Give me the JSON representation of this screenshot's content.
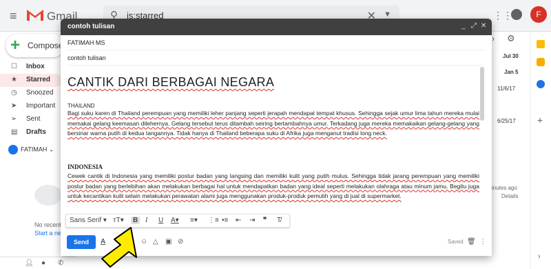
{
  "gmail": {
    "brand": "Gmail",
    "search_value": "is:starred",
    "compose_label": "Compose",
    "nav": [
      {
        "icon": "☐",
        "label": "Inbox",
        "bold": true
      },
      {
        "icon": "★",
        "label": "Starred",
        "bold": true,
        "active": true
      },
      {
        "icon": "◷",
        "label": "Snoozed",
        "bold": false
      },
      {
        "icon": "➤",
        "label": "Important",
        "bold": false
      },
      {
        "icon": "➢",
        "label": "Sent",
        "bold": false
      },
      {
        "icon": "▤",
        "label": "Drafts",
        "bold": true
      }
    ],
    "user_label": "FATIMAH ⌄",
    "avatar_letter": "F",
    "no_recent": "No recent c",
    "start_new": "Start a new",
    "dates": [
      "Jul 30",
      "Jan 5",
      "11/6/17",
      "6/25/17"
    ],
    "minutes_ago": "inutes ago",
    "details": "Details"
  },
  "compose": {
    "title": "contoh tulisan",
    "to": "FATIMAH MS",
    "subject": "contoh tulisan",
    "heading": "CANTIK DARI BERBAGAI NEGARA",
    "section1_label": "THAILAND",
    "section1_text": "Bagi suku karen di Thailand perempuan yang memiliki leher panjang seperti jerapah mendapat tempat khusus. Sehingga sejak umur lima tahun mereka mulai memakai gelang keemasan dilehernya. Gelang tersebut terus ditambah seiring bertambahnya umur. Terkadang juga mereka memakaikan gelang-gelang yang bersinar warna putih  di  kedua tangannya. Tidak hanya di Thailand beberapa suku di Afrika juga menganut tradisi long neck.",
    "section2_label": "INDONESIA",
    "section2_text": "Cewek cantik di Indonesia yang memiliki postur badan yang langsing dan memiliki kulit yang putih mulus. Sehingga tidak jarang perempuan yang memiliki postur badan yang berlebihan akan melakukan berbagai hal untuk mendapatkan badan yang ideal seperti melakukan olahraga atau minum jamu. Begitu juga untuk kecantikan kulit selain melakukan perawatan alami juga menggunakan produk-produk pemutih yang di jual di supermarket.",
    "font_select": "Sans Serif",
    "send_label": "Send",
    "saved_label": "Saved"
  },
  "colors": {
    "accent": "#1a73e8",
    "arrow": "#ffeb00",
    "title_bar": "#404040"
  }
}
